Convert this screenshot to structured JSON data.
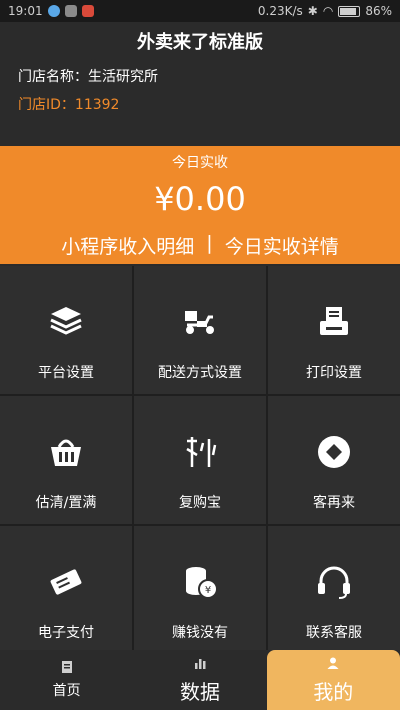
{
  "status_bar": {
    "time": "19:01",
    "network_speed": "0.23K/s",
    "battery": "86%"
  },
  "header": {
    "title": "外卖来了标准版",
    "store_name": "门店名称：生活研究所",
    "store_id": "门店ID：11392"
  },
  "revenue": {
    "label": "今日实收",
    "amount": "¥0.00",
    "link_mini_program": "小程序收入明细",
    "separator": "|",
    "link_details": "今日实收详情"
  },
  "grid": [
    {
      "label": "平台设置",
      "icon": "layers-icon"
    },
    {
      "label": "配送方式设置",
      "icon": "scooter-icon"
    },
    {
      "label": "打印设置",
      "icon": "printer-icon"
    },
    {
      "label": "估清/置满",
      "icon": "basket-icon"
    },
    {
      "label": "复购宝",
      "icon": "repurchase-icon"
    },
    {
      "label": "客再来",
      "icon": "diamond-icon"
    },
    {
      "label": "电子支付",
      "icon": "ticket-icon"
    },
    {
      "label": "赚钱没有",
      "icon": "coins-icon"
    },
    {
      "label": "联系客服",
      "icon": "headset-icon"
    }
  ],
  "bottom_nav": {
    "home": "首页",
    "data": "数据",
    "mine": "我的"
  },
  "colors": {
    "accent": "#f08a2a",
    "active_tab": "#f0b65f",
    "background": "#2b2b2b"
  }
}
